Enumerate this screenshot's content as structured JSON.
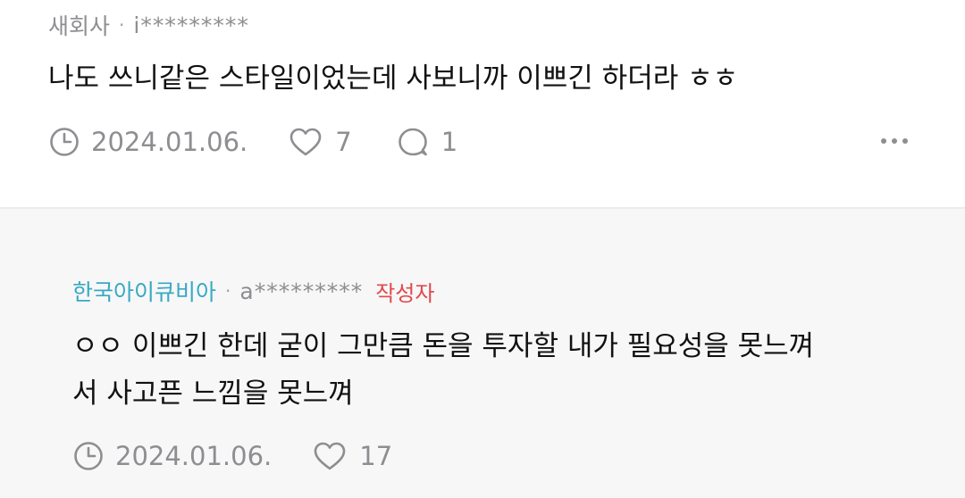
{
  "comments": [
    {
      "author": "새회사",
      "separator": "·",
      "handle": "i*********",
      "text": "나도 쓰니같은 스타일이었는데 사보니까 이쁘긴 하더라 ㅎㅎ",
      "date": "2024.01.06.",
      "likes": "7",
      "replies": "1",
      "icons": {
        "clock": "clock-icon",
        "heart": "heart-icon",
        "reply": "speech-bubble-icon",
        "more": "more-horizontal-icon"
      }
    },
    {
      "author": "한국아이큐비아",
      "separator": "·",
      "handle": "a*********",
      "badge": "작성자",
      "text_lines": [
        "ㅇㅇ 이쁘긴 한데 굳이 그만큼 돈을 투자할 내가 필요성을 못느껴",
        "서 사고픈 느낌을 못느껴"
      ],
      "date": "2024.01.06.",
      "likes": "17",
      "icons": {
        "clock": "clock-icon",
        "heart": "heart-icon"
      }
    }
  ],
  "colors": {
    "brand_author": "#38a9c2",
    "owner_badge": "#e04a4a",
    "muted_text": "#8e8e92",
    "reply_background": "#f7f7f8"
  }
}
